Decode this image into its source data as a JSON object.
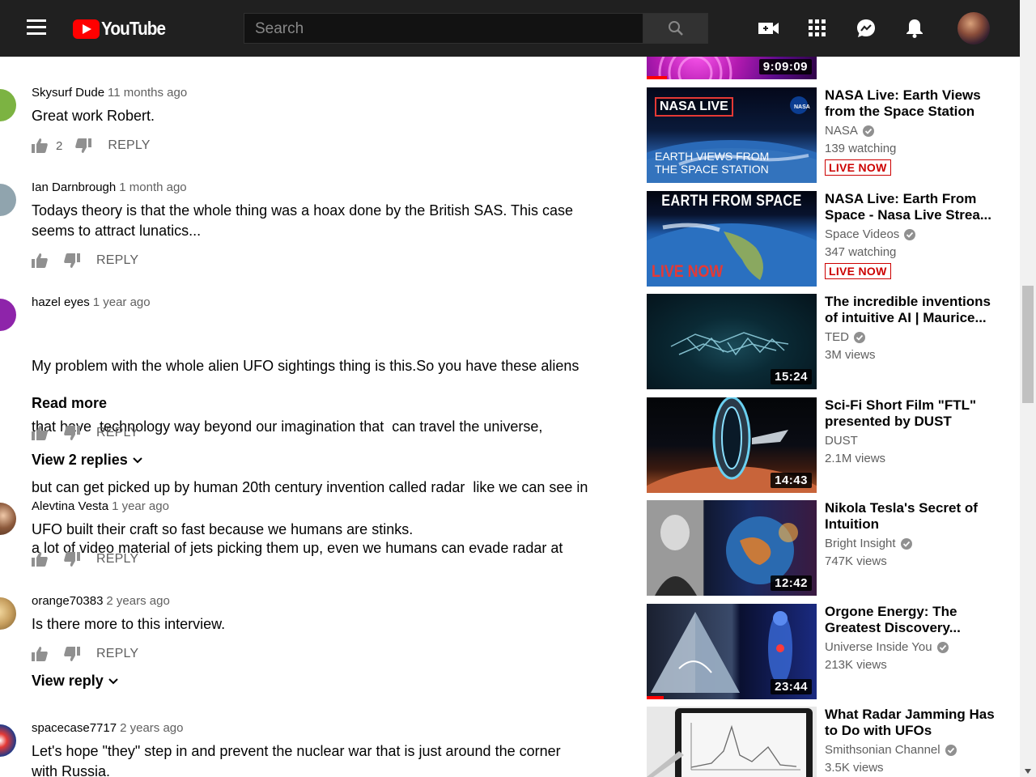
{
  "header": {
    "logo_text": "YouTube",
    "search_placeholder": "Search"
  },
  "comments": [
    {
      "author": "Skysurf Dude",
      "time": "11 months ago",
      "text": "Great work Robert.",
      "likes": "2",
      "reply_label": "REPLY",
      "avatar_color": "#7cb342"
    },
    {
      "author": "Ian Darnbrough",
      "time": "1 month ago",
      "text": "Todays theory is that the whole thing was a hoax done by the British SAS. This case seems to attract lunatics...",
      "likes": "",
      "reply_label": "REPLY",
      "avatar_color": "#90a4ae"
    },
    {
      "author": "hazel eyes",
      "time": "1 year ago",
      "text_lines": [
        "My problem with the whole alien UFO sightings thing is this.So you have these aliens",
        "that have  technology way beyond our imagination that  can travel the universe,",
        "but can get picked up by human 20th century invention called radar  like we can see in",
        "a lot of video material of jets picking them up, even we humans can evade radar at"
      ],
      "read_more": "Read more",
      "likes": "",
      "reply_label": "REPLY",
      "view_replies": "View 2 replies",
      "avatar_color": "#8e24aa"
    },
    {
      "author": "Alevtina Vesta",
      "time": "1 year ago",
      "text": "UFO built their craft so fast because we humans are stinks.",
      "likes": "",
      "reply_label": "REPLY",
      "avatar_color": "#6d4c41"
    },
    {
      "author": "orange70383",
      "time": "2 years ago",
      "text": "Is there more to this interview.",
      "likes": "",
      "reply_label": "REPLY",
      "view_replies": "View reply",
      "avatar_color": "#c8a060"
    },
    {
      "author": "spacecase7717",
      "time": "2 years ago",
      "text": "Let's hope \"they\" step in and prevent the nuclear war that is just around the corner with Russia.",
      "likes": "",
      "reply_label": "REPLY",
      "avatar_color": "#3949ab"
    }
  ],
  "videos": [
    {
      "title": "",
      "channel": "",
      "meta": "",
      "duration": "9:09:09",
      "progress_pct": 12
    },
    {
      "title": "NASA Live: Earth Views from the Space Station",
      "channel": "NASA",
      "verified": true,
      "meta": "139 watching",
      "live": "LIVE NOW",
      "thumb_text_top": "NASA LIVE",
      "thumb_text_bottom": "EARTH VIEWS FROM THE SPACE STATION"
    },
    {
      "title": "NASA Live: Earth From Space - Nasa Live Strea...",
      "channel": "Space Videos",
      "verified": true,
      "meta": "347 watching",
      "live": "LIVE NOW",
      "thumb_text_top": "EARTH FROM SPACE",
      "thumb_text_bottom": "LIVE NOW"
    },
    {
      "title": "The incredible inventions of intuitive AI | Maurice...",
      "channel": "TED",
      "verified": true,
      "meta": "3M views",
      "duration": "15:24"
    },
    {
      "title": "Sci-Fi Short Film \"FTL\" presented by DUST",
      "channel": "DUST",
      "verified": false,
      "meta": "2.1M views",
      "duration": "14:43"
    },
    {
      "title": "Nikola Tesla's Secret of Intuition",
      "channel": "Bright Insight",
      "verified": true,
      "meta": "747K views",
      "duration": "12:42"
    },
    {
      "title": "Orgone Energy: The Greatest Discovery...",
      "channel": "Universe Inside You",
      "verified": true,
      "meta": "213K views",
      "duration": "23:44",
      "progress_pct": 10
    },
    {
      "title": "What Radar Jamming Has to Do with UFOs",
      "channel": "Smithsonian Channel",
      "verified": true,
      "meta": "3.5K views"
    }
  ]
}
